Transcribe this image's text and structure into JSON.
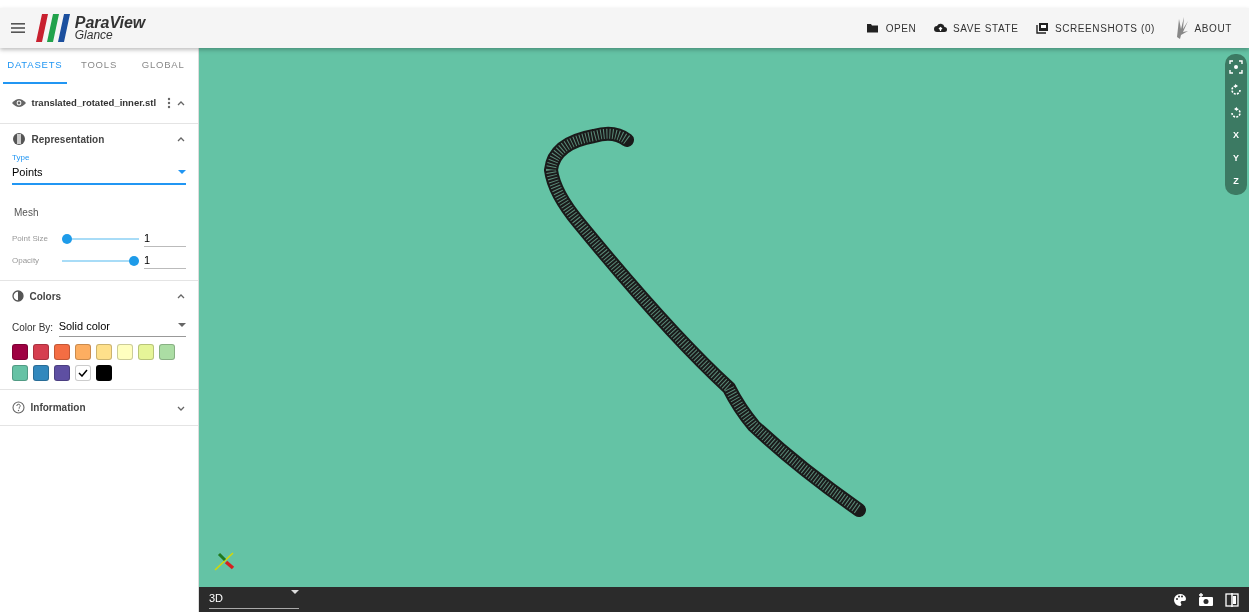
{
  "header": {
    "logo_title": "ParaView",
    "logo_subtitle": "Glance",
    "actions": [
      {
        "kind": "open",
        "label": "OPEN"
      },
      {
        "kind": "save",
        "label": "SAVE STATE"
      },
      {
        "kind": "screenshots",
        "label": "SCREENSHOTS (0)"
      },
      {
        "kind": "about",
        "label": "ABOUT"
      }
    ]
  },
  "tabs": [
    {
      "label": "DATASETS",
      "selected": true
    },
    {
      "label": "TOOLS",
      "selected": false
    },
    {
      "label": "GLOBAL",
      "selected": false
    }
  ],
  "dataset": {
    "name": "translated_rotated_inner.stl",
    "visible": true,
    "expanded": true
  },
  "representation": {
    "title": "Representation",
    "expanded": true,
    "type_label": "Type",
    "type_value": "Points",
    "mesh_label": "Mesh",
    "sliders": [
      {
        "label": "Point Size",
        "level": 0,
        "value": "1"
      },
      {
        "label": "Opacity",
        "level": 1,
        "value": "1"
      }
    ]
  },
  "colors": {
    "title": "Colors",
    "expanded": true,
    "color_by_label": "Color By:",
    "color_by_value": "Solid color",
    "swatches": [
      {
        "color": "#9e0142",
        "selected": false
      },
      {
        "color": "#d53e4f",
        "selected": false
      },
      {
        "color": "#f46d43",
        "selected": false
      },
      {
        "color": "#fdae61",
        "selected": false
      },
      {
        "color": "#fee08b",
        "selected": false
      },
      {
        "color": "#ffffbf",
        "selected": false
      },
      {
        "color": "#e6f598",
        "selected": false
      },
      {
        "color": "#abdda4",
        "selected": false
      },
      {
        "color": "#66c2a5",
        "selected": false
      },
      {
        "color": "#3288bd",
        "selected": false
      },
      {
        "color": "#5e4fa2",
        "selected": false
      },
      {
        "color": "#ffffff",
        "selected": true
      },
      {
        "color": "#000000",
        "selected": false
      }
    ]
  },
  "information": {
    "title": "Information",
    "expanded": false
  },
  "view_controls": [
    {
      "kind": "reset"
    },
    {
      "kind": "rotate-left"
    },
    {
      "kind": "rotate-right"
    },
    {
      "kind": "text",
      "label": "X"
    },
    {
      "kind": "text",
      "label": "Y"
    },
    {
      "kind": "text",
      "label": "Z"
    }
  ],
  "bottom_bar": {
    "view_type": "3D"
  }
}
